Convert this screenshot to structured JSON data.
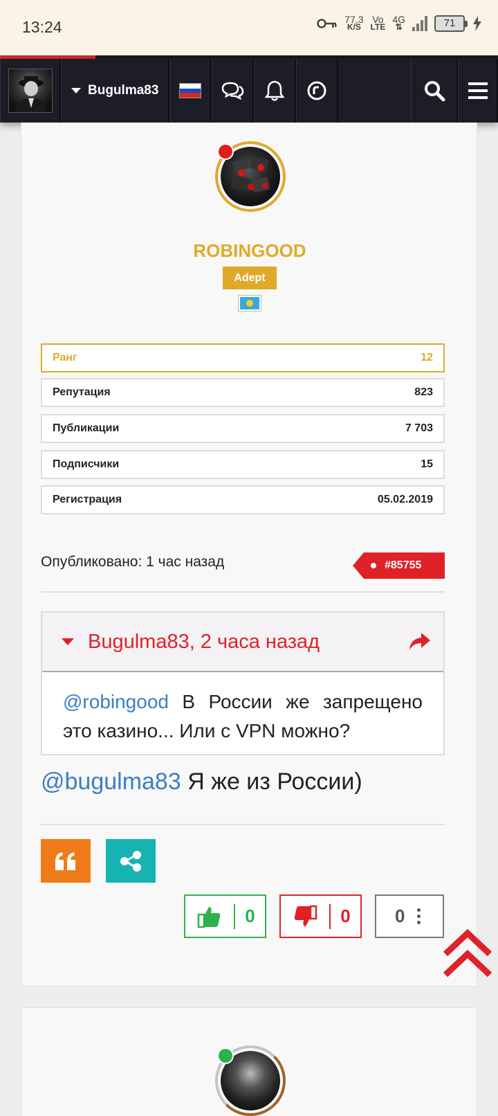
{
  "status_bar": {
    "time": "13:24",
    "speed_value": "77,3",
    "speed_unit": "K/S",
    "volte_top": "Vo",
    "volte_bottom": "LTE",
    "network": "4G",
    "battery": "71"
  },
  "navbar": {
    "username": "Bugulma83",
    "icons": [
      "user-avatar",
      "russia-flag-icon",
      "chat-icon",
      "bell-icon",
      "activity-icon",
      "search-icon",
      "menu-icon"
    ]
  },
  "post": {
    "author": {
      "name": "ROBINGOOD",
      "badge": "Adept",
      "flag": "kazakhstan-flag",
      "status_color": "#e01e1e"
    },
    "stats": [
      {
        "label": "Ранг",
        "value": "12"
      },
      {
        "label": "Репутация",
        "value": "823"
      },
      {
        "label": "Публикации",
        "value": "7 703"
      },
      {
        "label": "Подписчики",
        "value": "15"
      },
      {
        "label": "Регистрация",
        "value": "05.02.2019"
      }
    ],
    "published": "Опубликовано: 1 час назад",
    "post_number": "#85755",
    "quote": {
      "author_line": "Bugulma83, 2 часа назад",
      "mention": "@robingood",
      "text": " В России же запрещено это казино... Или с VPN можно?"
    },
    "body_mention": "@bugulma83",
    "body_text": " Я же из России)",
    "likes": "0",
    "dislikes": "0",
    "reactions": "0"
  },
  "colors": {
    "accent_gold": "#e0a92a",
    "accent_red": "#df2228",
    "like_green": "#2db24a",
    "quote_orange": "#ef7b18",
    "share_teal": "#17b3b3",
    "nav_bg": "#1c1d27"
  }
}
